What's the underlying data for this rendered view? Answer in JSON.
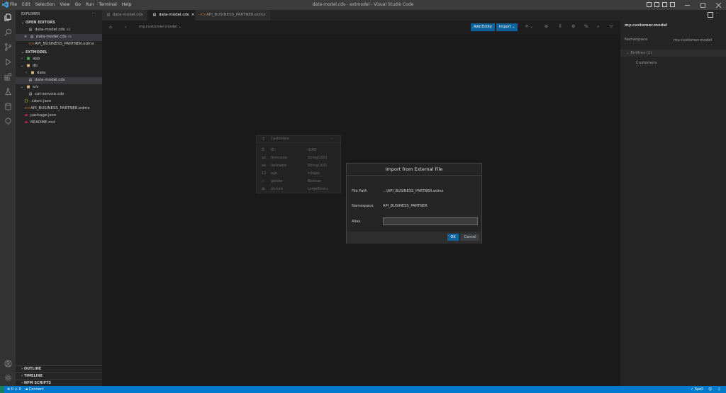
{
  "titlebar": {
    "menu": [
      "File",
      "Edit",
      "Selection",
      "View",
      "Go",
      "Run",
      "Terminal",
      "Help"
    ],
    "title": "data-model.cds - extmodel - Visual Studio Code"
  },
  "sidebar": {
    "explorer_title": "EXPLORER",
    "explorer_more": "···",
    "open_editors_title": "OPEN EDITORS",
    "open_editors": [
      {
        "name": "data-model.cds",
        "desc": "db"
      },
      {
        "name": "data-model.cds",
        "desc": "db"
      },
      {
        "name": "API_BUSINESS_PARTNER.edmx",
        "desc": ""
      }
    ],
    "workspace_title": "EXTMODEL",
    "tree": [
      {
        "name": "app",
        "icon": "›"
      },
      {
        "name": "db",
        "icon": "⌄"
      },
      {
        "name": "data",
        "icon": "›"
      },
      {
        "name": "data-model.cds",
        "icon": ""
      },
      {
        "name": "srv",
        "icon": "⌄"
      },
      {
        "name": "cat-service.cds",
        "icon": ""
      },
      {
        "name": ".cdsrc.json",
        "icon": ""
      },
      {
        "name": "API_BUSINESS_PARTNER.edmx",
        "icon": ""
      },
      {
        "name": "package.json",
        "icon": ""
      },
      {
        "name": "README.md",
        "icon": ""
      }
    ],
    "outline": "OUTLINE",
    "timeline": "TIMELINE",
    "npm_scripts": "NPM SCRIPTS"
  },
  "tabs": [
    {
      "label": "data-model.cds"
    },
    {
      "label": "data-model.cds"
    },
    {
      "label": "API_BUSINESS_PARTNER.edmx"
    }
  ],
  "toolbar": {
    "namespace": "my.customer.model",
    "add_entity": "Add Entity",
    "import": "Import",
    "add_symbol": "+"
  },
  "right_panel": {
    "title": "my.customer.model",
    "namespace_label": "Namespace",
    "namespace_value": "my.customer.model",
    "entities_header": "Entities (1)",
    "entities": [
      "Customers"
    ]
  },
  "entity": {
    "name": "Customers",
    "more": "···",
    "fields": [
      {
        "icon": "⚿",
        "name": "ID",
        "type": "UUID"
      },
      {
        "icon": "ab",
        "name": "firstname",
        "type": "String(100)"
      },
      {
        "icon": "ab",
        "name": "lastname",
        "type": "String(100)"
      },
      {
        "icon": "12",
        "name": "age",
        "type": "Integer"
      },
      {
        "icon": "✓",
        "name": "gender",
        "type": "Boolean"
      },
      {
        "icon": "▤",
        "name": "picture",
        "type": "LargeBinary"
      }
    ]
  },
  "dialog": {
    "title": "Import from External File",
    "file_path_label": "File Path",
    "file_path_value": "...\\API_BUSINESS_PARTNER.edmx",
    "namespace_label": "Namespace",
    "namespace_value": "API_BUSINESS_PARTNER",
    "alias_label": "Alias",
    "alias_value": "",
    "ok": "OK",
    "cancel": "Cancel"
  },
  "statusbar": {
    "problems": "⊗ 0 ⚠ 0",
    "connect": "Connect",
    "spell": "Spell"
  },
  "colors": {
    "accent": "#007acc",
    "button": "#0e639c"
  }
}
